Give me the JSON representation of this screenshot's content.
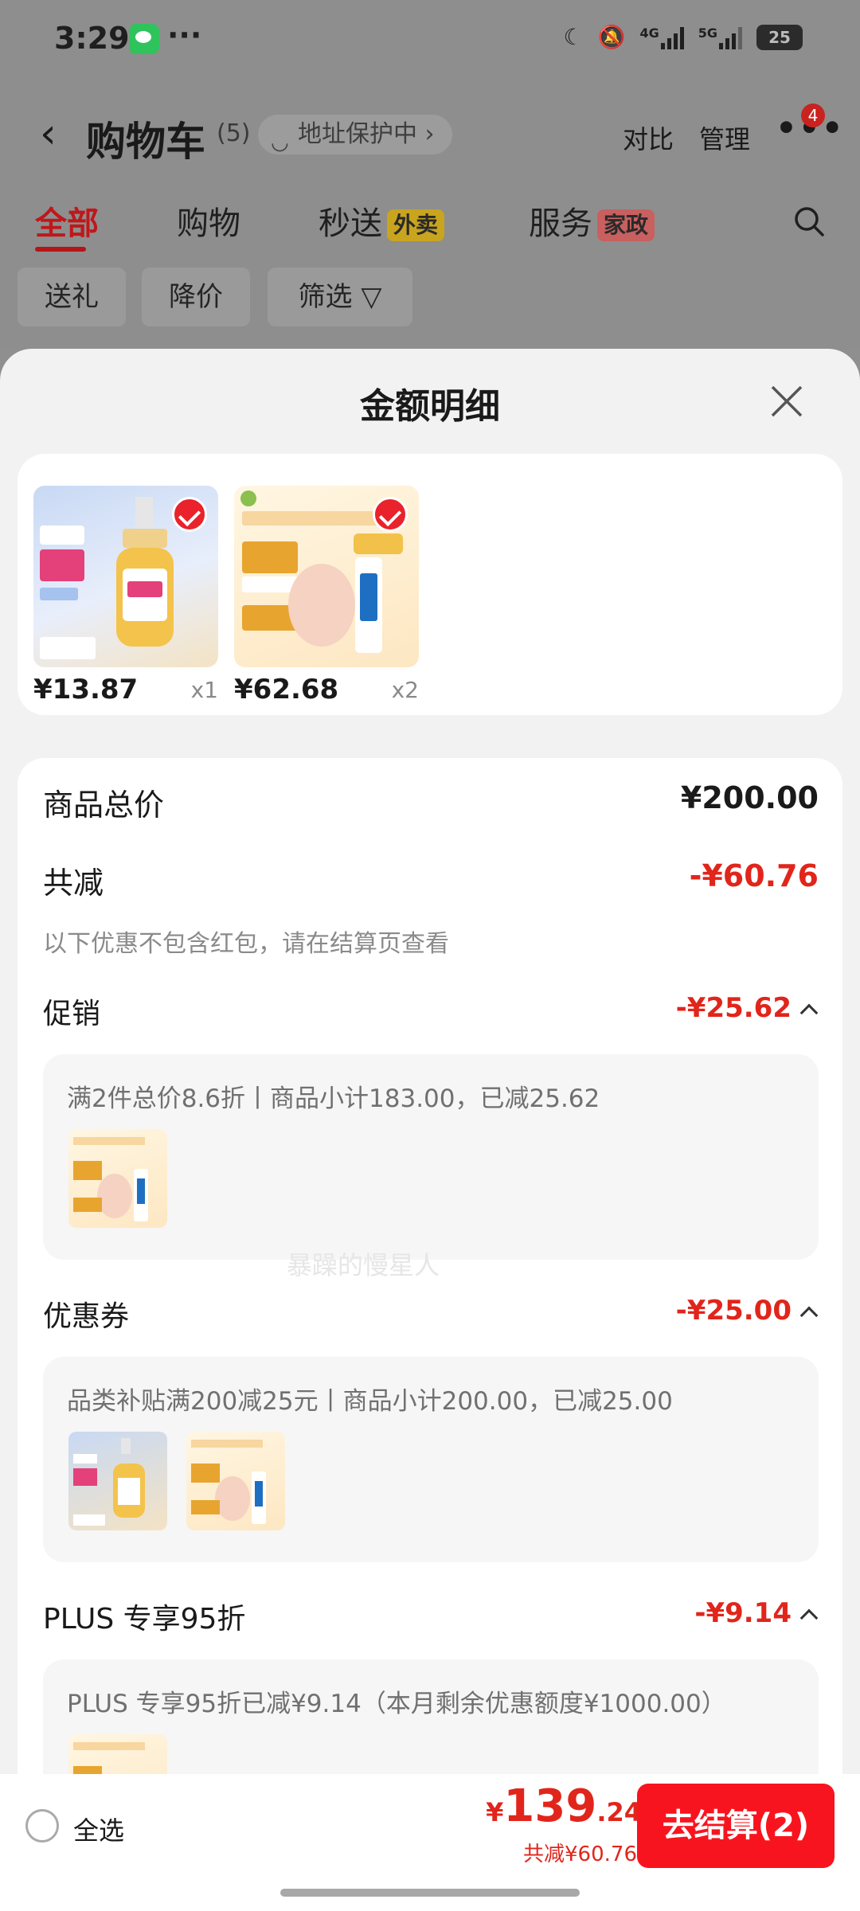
{
  "status_bar": {
    "time": "3:29",
    "more": "···",
    "net1": "4G",
    "net2": "5G",
    "battery": "25"
  },
  "nav": {
    "back": "‹",
    "title": "购物车",
    "count": "(5)",
    "address_pill": "地址保护中 ›",
    "compare": "对比",
    "manage": "管理",
    "more": "•••",
    "badge": "4"
  },
  "tabs": [
    {
      "label": "全部"
    },
    {
      "label": "购物"
    },
    {
      "label": "秒送",
      "tag": "外卖"
    },
    {
      "label": "服务",
      "tag": "家政"
    }
  ],
  "filters": [
    "送礼",
    "降价",
    "筛选 ▽"
  ],
  "sheet": {
    "title": "金额明细",
    "products": [
      {
        "price": "¥13.87",
        "qty": "x1"
      },
      {
        "price": "¥62.68",
        "qty": "x2"
      }
    ],
    "goods_total_label": "商品总价",
    "goods_total_value": "¥200.00",
    "total_discount_label": "共减",
    "total_discount_value": "-¥60.76",
    "note": "以下优惠不包含红包，请在结算页查看",
    "watermark": "暴躁的慢星人",
    "sections": [
      {
        "label": "促销",
        "value": "-¥25.62",
        "desc": "满2件总价8.6折丨商品小计183.00，已减25.62"
      },
      {
        "label": "优惠券",
        "value": "-¥25.00",
        "desc": "品类补贴满200减25元丨商品小计200.00，已减25.00"
      },
      {
        "label": "PLUS 专享95折",
        "value": "-¥9.14",
        "desc": "PLUS 专享95折已减¥9.14（本月剩余优惠额度¥1000.00）"
      }
    ]
  },
  "footer": {
    "select_all": "全选",
    "currency": "¥",
    "total_int": "139",
    "total_dec": ".24",
    "saved": "共减¥60.76",
    "checkout": "去结算(2)"
  },
  "colors": {
    "accent_red": "#e1251b",
    "checkout_red": "#f8141e",
    "active_tab": "#c0171a"
  },
  "icons": [
    "wechat-icon",
    "moon-icon",
    "mute-icon",
    "signal-icon",
    "battery-icon",
    "back-icon",
    "shield-icon",
    "more-icon",
    "search-icon",
    "filter-icon",
    "close-icon",
    "check-icon",
    "chevron-up-icon",
    "chevron-down-icon",
    "radio-icon"
  ]
}
